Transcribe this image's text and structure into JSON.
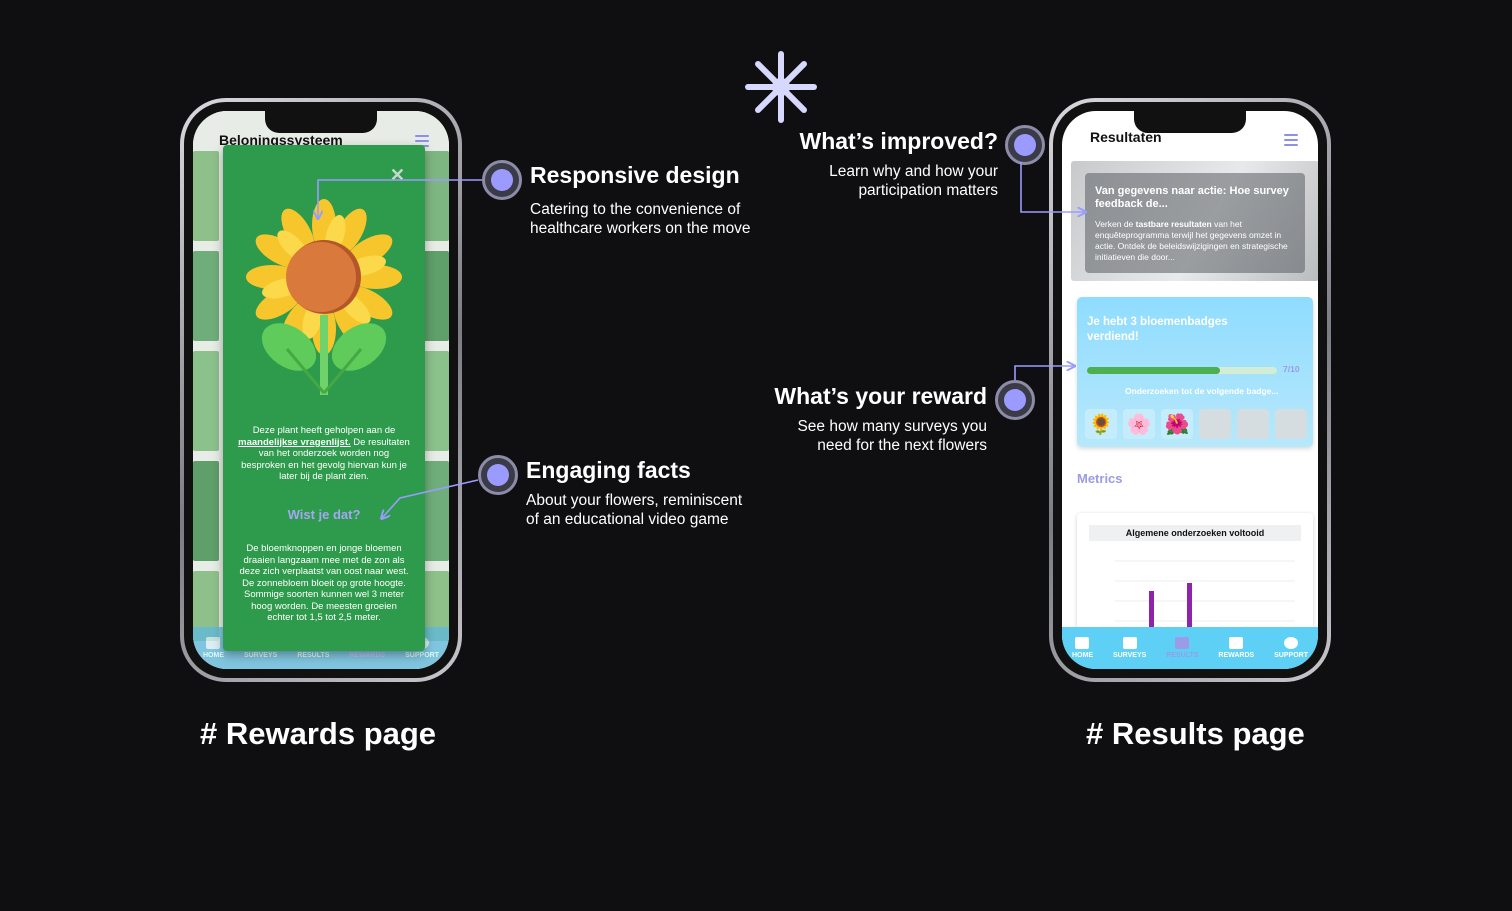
{
  "rewards_phone": {
    "title": "Beloningssysteem",
    "close": "✕",
    "plant_text_1": "Deze plant heeft geholpen aan de",
    "plant_link": "maandelijkse vragenlijst.",
    "plant_text_2": "De resultaten van het onderzoek worden nog besproken en het gevolg hiervan kun je later bij de plant zien.",
    "did_you_know": "Wist je dat?",
    "fact": "De bloemknoppen en jonge bloemen draaien langzaam mee met de zon als deze zich verplaatst van oost naar west. De zonnebloem bloeit op grote hoogte. Sommige soorten kunnen wel 3 meter hoog worden. De meesten groeien echter tot 1,5 tot 2,5 meter.",
    "tabs": [
      "HOME",
      "SURVEYS",
      "RESULTS",
      "REWARDS",
      "SUPPORT"
    ],
    "active_tab": "REWARDS"
  },
  "results_phone": {
    "title": "Resultaten",
    "card_title": "Van gegevens naar actie: Hoe survey feedback de...",
    "card_body_1": "Verken de",
    "card_body_bold": "tastbare resultaten",
    "card_body_2": "van het enquêteprogramma terwijl het gegevens omzet in actie. Ontdek de beleidswijzigingen en strategische initiatieven die door...",
    "badge_title": "Je hebt 3 bloemenbadges verdiend!",
    "progress_label": "7/10",
    "progress_fraction": 0.7,
    "next_badge": "Onderzoeken tot de volgende badge...",
    "badges": [
      "🌻",
      "🌸",
      "🌺"
    ],
    "metrics": "Metrics",
    "chart_title": "Algemene onderzoeken voltooid",
    "tabs": [
      "HOME",
      "SURVEYS",
      "RESULTS",
      "REWARDS",
      "SUPPORT"
    ],
    "active_tab": "RESULTS"
  },
  "annotations": {
    "responsive_title": "Responsive design",
    "responsive_text": "Catering to the convenience of healthcare workers on the move",
    "facts_title": "Engaging facts",
    "facts_text": "About your flowers, reminiscent of an educational video game",
    "improved_title": "What’s improved?",
    "improved_text": "Learn why and how your participation matters",
    "reward_title": "What’s your reward",
    "reward_text": "See how many surveys you need for the next flowers"
  },
  "captions": {
    "rewards": "# Rewards page",
    "results": "# Results page"
  },
  "colors": {
    "accent": "#9b9bff",
    "modal_green": "#2e9a4c",
    "tabbar_blue": "#5fd0f5",
    "bar_purple": "#8e24aa"
  }
}
